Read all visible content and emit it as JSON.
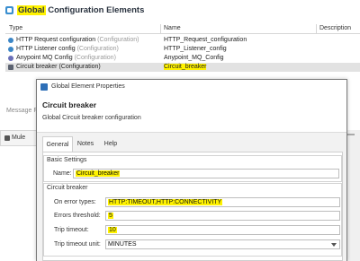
{
  "editor": {
    "title_highlight": "Global",
    "title_rest": " Configuration Elements",
    "columns": {
      "type": "Type",
      "name": "Name",
      "description": "Description"
    },
    "rows": [
      {
        "type": "HTTP Request configuration",
        "suffix": " (Configuration)",
        "name": "HTTP_Request_configuration",
        "icon": "http-icon"
      },
      {
        "type": "HTTP Listener config",
        "suffix": " (Configuration)",
        "name": "HTTP_Listener_config",
        "icon": "http-icon"
      },
      {
        "type": "Anypoint MQ Config",
        "suffix": " (Configuration)",
        "name": "Anypoint_MQ_Config",
        "icon": "mq-icon"
      },
      {
        "type": "Circuit breaker (Configuration)",
        "suffix": "",
        "name": "Circuit_breaker",
        "icon": "circuit-breaker-icon"
      }
    ],
    "message_label": "Message F",
    "bottom_tab": "Mule"
  },
  "dialog": {
    "window_title": "Global Element Properties",
    "banner_title": "Circuit breaker",
    "banner_subtitle": "Global Circuit breaker configuration",
    "tabs": [
      "General",
      "Notes",
      "Help"
    ],
    "basic_settings": {
      "group_label": "Basic Settings",
      "name_label": "Name:",
      "name_value": "Circuit_breaker"
    },
    "circuit_breaker": {
      "group_label": "Circuit breaker",
      "on_error_types_label": "On error types:",
      "on_error_types_value": "HTTP:TIMEOUT,HTTP:CONNECTIVITY",
      "errors_threshold_label": "Errors threshold:",
      "errors_threshold_value": "5",
      "trip_timeout_label": "Trip timeout:",
      "trip_timeout_value": "10",
      "trip_timeout_unit_label": "Trip timeout unit:",
      "trip_timeout_unit_value": "MINUTES"
    }
  },
  "colors": {
    "highlight": "#fff200",
    "selected_row": "#e2e2e2",
    "accent": "#2e6fb7"
  }
}
